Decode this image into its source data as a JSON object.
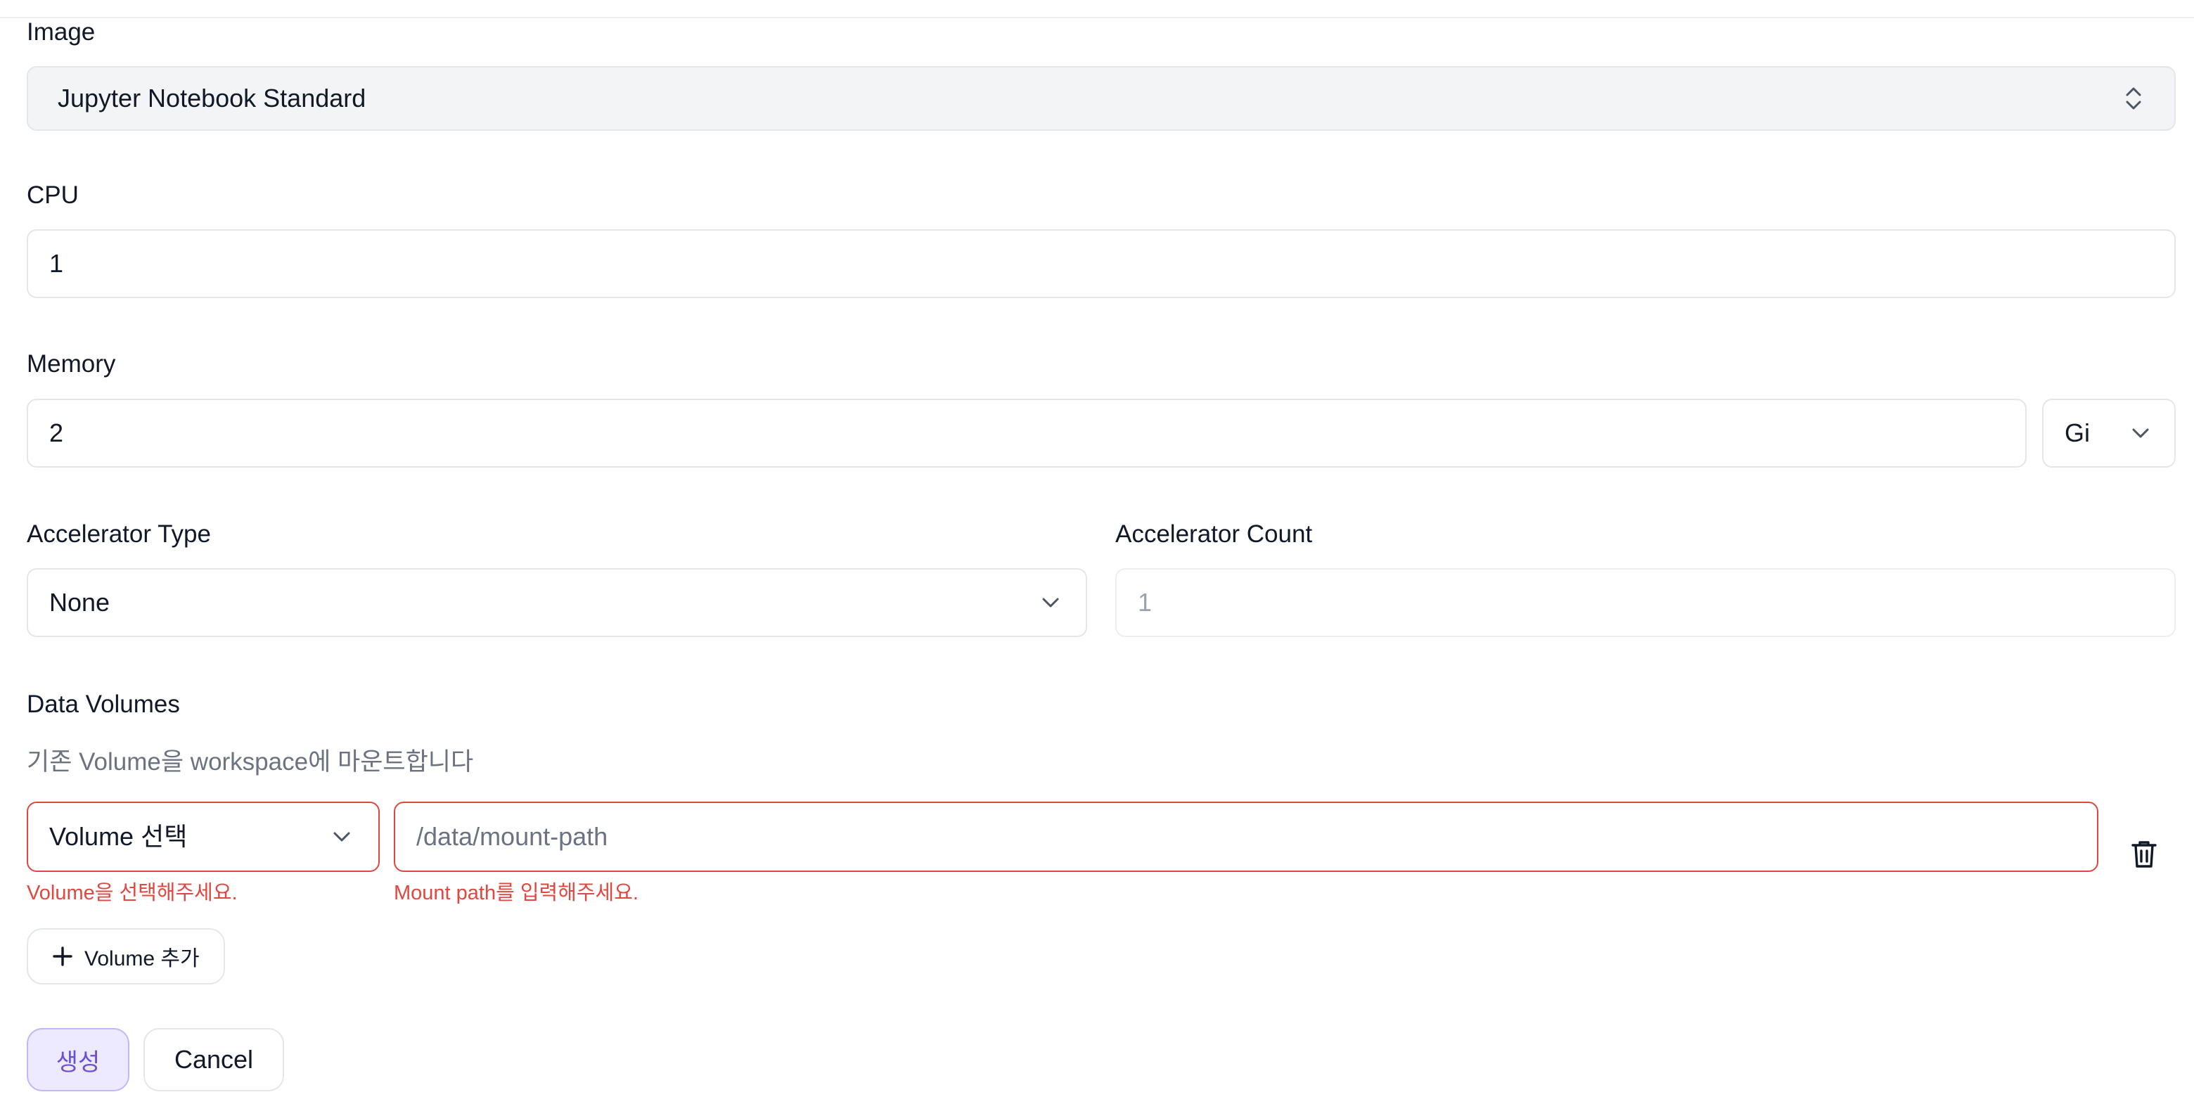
{
  "image_field": {
    "label": "Image",
    "value": "Jupyter Notebook Standard",
    "icon": "chevron-up-down-icon"
  },
  "cpu_field": {
    "label": "CPU",
    "value": "1"
  },
  "memory_field": {
    "label": "Memory",
    "value": "2",
    "unit": "Gi",
    "unit_icon": "chevron-down-icon"
  },
  "accelerator_type": {
    "label": "Accelerator Type",
    "value": "None",
    "icon": "chevron-down-icon"
  },
  "accelerator_count": {
    "label": "Accelerator Count",
    "placeholder": "1"
  },
  "data_volumes": {
    "label": "Data Volumes",
    "helper": "기존 Volume을 workspace에 마운트합니다",
    "volume_select": {
      "value": "Volume 선택",
      "error": "Volume을 선택해주세요."
    },
    "mount_path": {
      "placeholder": "/data/mount-path",
      "error": "Mount path를 입력해주세요."
    },
    "delete_icon": "trash-icon",
    "add_button": {
      "label": "Volume 추가",
      "icon": "plus-icon"
    }
  },
  "actions": {
    "create_label": "생성",
    "cancel_label": "Cancel"
  },
  "colors": {
    "error": "#e0473f",
    "primary_soft_bg": "#ede9fe",
    "primary_text": "#6d4fd1",
    "border": "#e3e6ea",
    "grey_bg": "#f3f4f6"
  }
}
